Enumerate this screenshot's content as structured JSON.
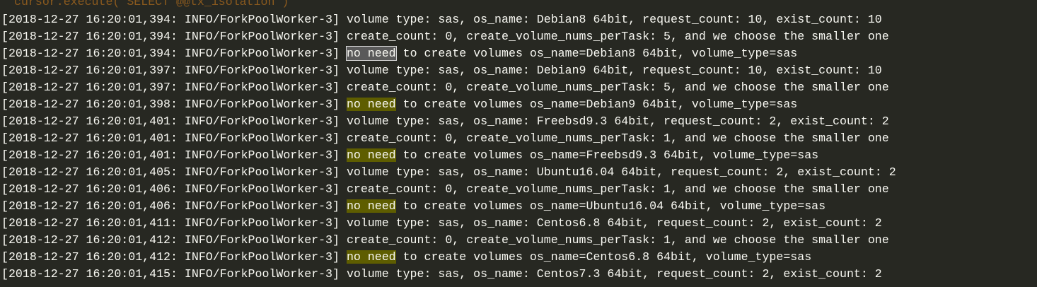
{
  "code_line": "cursor.execute( SELECT @@tx_isolation )",
  "highlight_term": "no need",
  "colors": {
    "background": "#272822",
    "highlight": "#5e5d00",
    "selection": "#5a5a5a",
    "code": "#8b5a1e"
  },
  "lines": [
    {
      "prefix": "[2018-12-27 16:20:01,394: INFO/ForkPoolWorker-3] ",
      "hl": "",
      "text": "volume type: sas, os_name: Debian8 64bit, request_count: 10, exist_count: 10"
    },
    {
      "prefix": "[2018-12-27 16:20:01,394: INFO/ForkPoolWorker-3] ",
      "hl": "",
      "text": "create_count: 0, create_volume_nums_perTask: 5, and we choose the smaller one"
    },
    {
      "prefix": "[2018-12-27 16:20:01,394: INFO/ForkPoolWorker-3] ",
      "hl": "sel",
      "text": " to create volumes os_name=Debian8 64bit, volume_type=sas"
    },
    {
      "prefix": "[2018-12-27 16:20:01,397: INFO/ForkPoolWorker-3] ",
      "hl": "",
      "text": "volume type: sas, os_name: Debian9 64bit, request_count: 10, exist_count: 10"
    },
    {
      "prefix": "[2018-12-27 16:20:01,397: INFO/ForkPoolWorker-3] ",
      "hl": "",
      "text": "create_count: 0, create_volume_nums_perTask: 5, and we choose the smaller one"
    },
    {
      "prefix": "[2018-12-27 16:20:01,398: INFO/ForkPoolWorker-3] ",
      "hl": "hl",
      "text": " to create volumes os_name=Debian9 64bit, volume_type=sas"
    },
    {
      "prefix": "[2018-12-27 16:20:01,401: INFO/ForkPoolWorker-3] ",
      "hl": "",
      "text": "volume type: sas, os_name: Freebsd9.3 64bit, request_count: 2, exist_count: 2"
    },
    {
      "prefix": "[2018-12-27 16:20:01,401: INFO/ForkPoolWorker-3] ",
      "hl": "",
      "text": "create_count: 0, create_volume_nums_perTask: 1, and we choose the smaller one"
    },
    {
      "prefix": "[2018-12-27 16:20:01,401: INFO/ForkPoolWorker-3] ",
      "hl": "hl",
      "text": " to create volumes os_name=Freebsd9.3 64bit, volume_type=sas"
    },
    {
      "prefix": "[2018-12-27 16:20:01,405: INFO/ForkPoolWorker-3] ",
      "hl": "",
      "text": "volume type: sas, os_name: Ubuntu16.04 64bit, request_count: 2, exist_count: 2"
    },
    {
      "prefix": "[2018-12-27 16:20:01,406: INFO/ForkPoolWorker-3] ",
      "hl": "",
      "text": "create_count: 0, create_volume_nums_perTask: 1, and we choose the smaller one"
    },
    {
      "prefix": "[2018-12-27 16:20:01,406: INFO/ForkPoolWorker-3] ",
      "hl": "hl",
      "text": " to create volumes os_name=Ubuntu16.04 64bit, volume_type=sas"
    },
    {
      "prefix": "[2018-12-27 16:20:01,411: INFO/ForkPoolWorker-3] ",
      "hl": "",
      "text": "volume type: sas, os_name: Centos6.8 64bit, request_count: 2, exist_count: 2"
    },
    {
      "prefix": "[2018-12-27 16:20:01,412: INFO/ForkPoolWorker-3] ",
      "hl": "",
      "text": "create_count: 0, create_volume_nums_perTask: 1, and we choose the smaller one"
    },
    {
      "prefix": "[2018-12-27 16:20:01,412: INFO/ForkPoolWorker-3] ",
      "hl": "hl",
      "text": " to create volumes os_name=Centos6.8 64bit, volume_type=sas"
    },
    {
      "prefix": "[2018-12-27 16:20:01,415: INFO/ForkPoolWorker-3] ",
      "hl": "",
      "text": "volume type: sas, os_name: Centos7.3 64bit, request_count: 2, exist_count: 2"
    }
  ]
}
